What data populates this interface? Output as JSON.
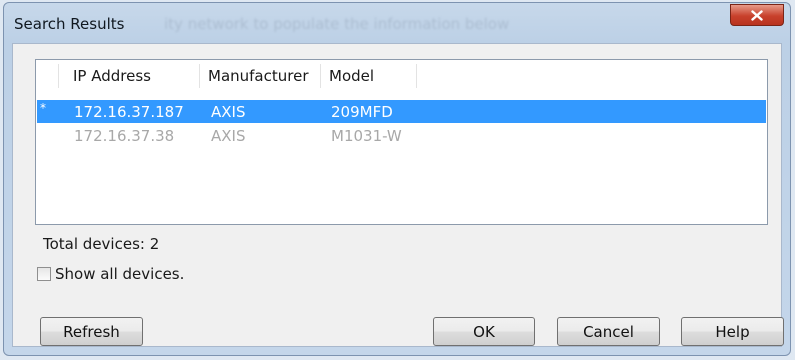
{
  "dialog": {
    "title": "Search Results",
    "ghost_text": "ity network to populate the information below",
    "close_glyph": "X"
  },
  "table": {
    "columns": [
      "",
      "IP Address",
      "Manufacturer",
      "Model"
    ],
    "rows": [
      {
        "marker": "*",
        "ip": "172.16.37.187",
        "manufacturer": "AXIS",
        "model": "209MFD",
        "selected": true
      },
      {
        "marker": "",
        "ip": "172.16.37.38",
        "manufacturer": "AXIS",
        "model": "M1031-W",
        "selected": false
      }
    ]
  },
  "total_devices_label": "Total devices: 2",
  "show_all": {
    "label": "Show all devices.",
    "checked": false
  },
  "buttons": {
    "refresh": "Refresh",
    "ok": "OK",
    "cancel": "Cancel",
    "help": "Help"
  },
  "colors": {
    "selection": "#3399ff",
    "close_button": "#c8412c"
  }
}
